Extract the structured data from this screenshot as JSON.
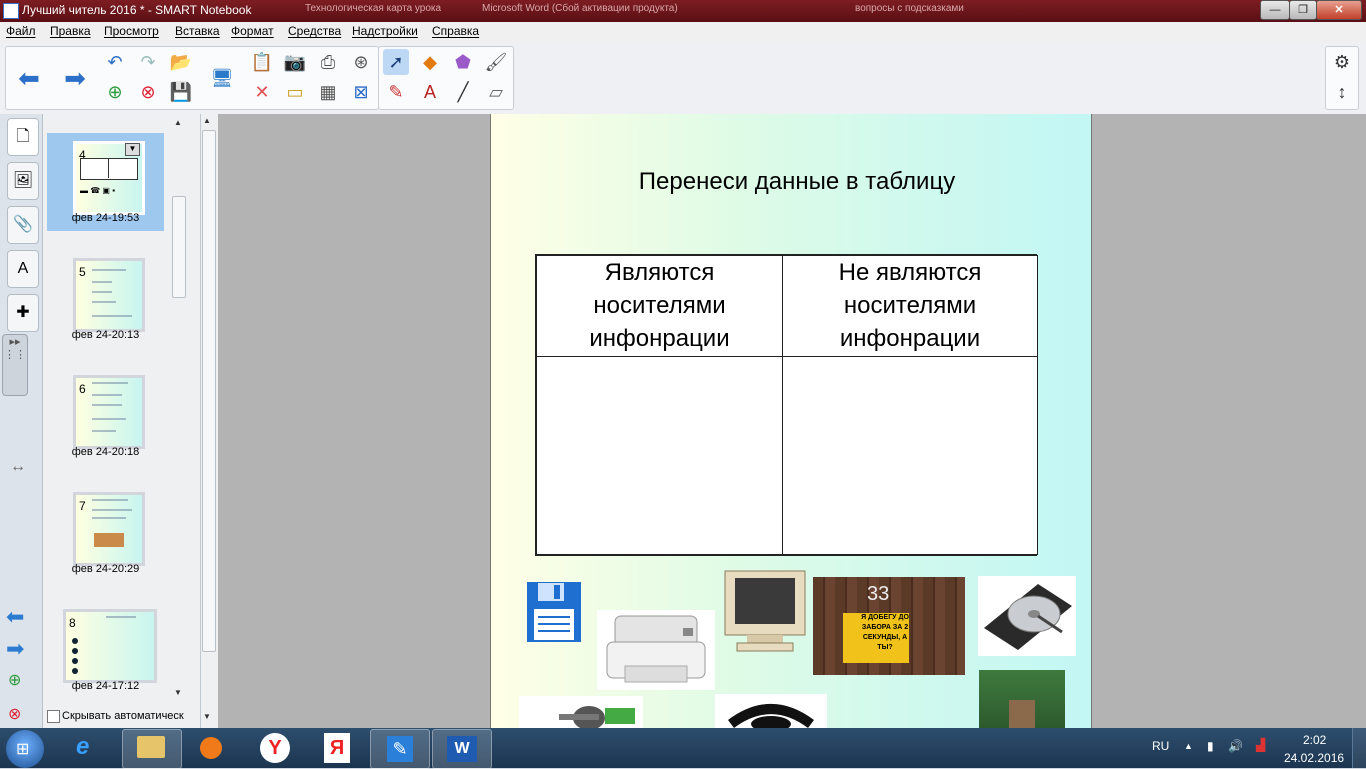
{
  "window": {
    "title": "Лучший читель 2016 * - SMART Notebook",
    "background_ghost_1": "Технологическая карта урока",
    "background_ghost_2": "Microsoft Word (Сбой активации продукта)",
    "background_ghost_3": "вопросы с подсказками"
  },
  "menu": [
    "Файл",
    "Правка",
    "Просмотр",
    "Вставка",
    "Формат",
    "Средства",
    "Надстройки",
    "Справка"
  ],
  "toolbar": {
    "back_icon": "arrow-left-icon",
    "forward_icon": "arrow-right-icon",
    "settings_icon": "gear-icon",
    "move_toolbar_icon": "up-down-arrow-icon"
  },
  "sorter": {
    "pages": [
      {
        "num": "4",
        "label": "фев 24-19:53",
        "selected": true
      },
      {
        "num": "5",
        "label": "фев 24-20:13",
        "selected": false
      },
      {
        "num": "6",
        "label": "фев 24-20:18",
        "selected": false
      },
      {
        "num": "7",
        "label": "фев 24-20:29",
        "selected": false
      },
      {
        "num": "8",
        "label": "фев 24-17:12",
        "selected": false
      }
    ],
    "autohide_label": "Скрывать автоматическ"
  },
  "page": {
    "title": "Перенеси данные в таблицу",
    "table": {
      "col1_header": [
        "Являются",
        "носителями",
        "инфонрации"
      ],
      "col2_header": [
        "Не являются",
        "носителями",
        "инфонрации"
      ]
    },
    "sign_number": "33",
    "sign_text": "Я ДОБЕГУ ДО ЗАБОРА ЗА 2 СЕКУНДЫ, А ТЫ?"
  },
  "taskbar": {
    "language": "RU",
    "time": "2:02",
    "date": "24.02.2016"
  }
}
